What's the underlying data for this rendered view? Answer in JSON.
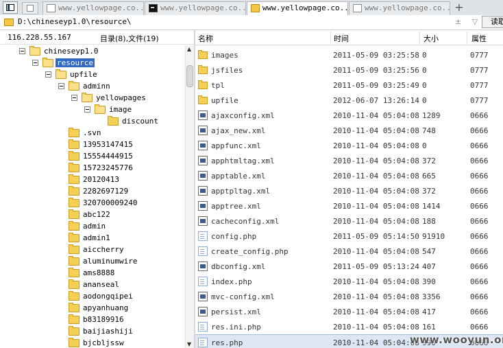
{
  "tabs": [
    {
      "label": "www.yellowpage.co...",
      "icon": "page-icon",
      "active": false
    },
    {
      "label": "www.yellowpage.co...",
      "icon": "terminal-icon",
      "active": false
    },
    {
      "label": "www.yellowpage.co...",
      "icon": "folder-icon",
      "active": true
    },
    {
      "label": "www.yellowpage.co...",
      "icon": "page-icon",
      "active": false
    }
  ],
  "new_tab_label": "+",
  "address": {
    "path": "D:\\chineseyp1.0\\resource\\",
    "buttons": "± ▽",
    "read_button": "读取"
  },
  "info": {
    "ip": "116.228.55.167",
    "counts": "目录(8),文件(19)"
  },
  "tree": [
    {
      "label": "chineseyp1.0",
      "depth": 0,
      "expander": true,
      "selected": false
    },
    {
      "label": "resource",
      "depth": 1,
      "expander": true,
      "selected": true
    },
    {
      "label": "upfile",
      "depth": 2,
      "expander": true,
      "selected": false
    },
    {
      "label": "adminn",
      "depth": 3,
      "expander": true,
      "selected": false
    },
    {
      "label": "yellowpages",
      "depth": 4,
      "expander": true,
      "selected": false
    },
    {
      "label": "image",
      "depth": 5,
      "expander": true,
      "selected": false
    },
    {
      "label": "discount",
      "depth": 6,
      "expander": false,
      "selected": false
    },
    {
      "label": ".svn",
      "depth": 3,
      "expander": false,
      "selected": false
    },
    {
      "label": "13953147415",
      "depth": 3,
      "expander": false,
      "selected": false
    },
    {
      "label": "15554444915",
      "depth": 3,
      "expander": false,
      "selected": false
    },
    {
      "label": "15723245776",
      "depth": 3,
      "expander": false,
      "selected": false
    },
    {
      "label": "20120413",
      "depth": 3,
      "expander": false,
      "selected": false
    },
    {
      "label": "2282697129",
      "depth": 3,
      "expander": false,
      "selected": false
    },
    {
      "label": "320700009240",
      "depth": 3,
      "expander": false,
      "selected": false
    },
    {
      "label": "abc122",
      "depth": 3,
      "expander": false,
      "selected": false
    },
    {
      "label": "admin",
      "depth": 3,
      "expander": false,
      "selected": false
    },
    {
      "label": "admin1",
      "depth": 3,
      "expander": false,
      "selected": false
    },
    {
      "label": "aiccherry",
      "depth": 3,
      "expander": false,
      "selected": false
    },
    {
      "label": "aluminumwire",
      "depth": 3,
      "expander": false,
      "selected": false
    },
    {
      "label": "ams8888",
      "depth": 3,
      "expander": false,
      "selected": false
    },
    {
      "label": "ananseal",
      "depth": 3,
      "expander": false,
      "selected": false
    },
    {
      "label": "aodongqipei",
      "depth": 3,
      "expander": false,
      "selected": false
    },
    {
      "label": "apyanhuang",
      "depth": 3,
      "expander": false,
      "selected": false
    },
    {
      "label": "b83189916",
      "depth": 3,
      "expander": false,
      "selected": false
    },
    {
      "label": "baijiashiji",
      "depth": 3,
      "expander": false,
      "selected": false
    },
    {
      "label": "bjcbljssw",
      "depth": 3,
      "expander": false,
      "selected": false
    }
  ],
  "columns": {
    "name": "名称",
    "time": "时间",
    "size": "大小",
    "attr": "属性"
  },
  "files": [
    {
      "name": "images",
      "type": "dir",
      "time": "2011-05-09 03:25:58",
      "size": "0",
      "attr": "0777"
    },
    {
      "name": "jsfiles",
      "type": "dir",
      "time": "2011-05-09 03:25:56",
      "size": "0",
      "attr": "0777"
    },
    {
      "name": "tpl",
      "type": "dir",
      "time": "2011-05-09 03:25:49",
      "size": "0",
      "attr": "0777"
    },
    {
      "name": "upfile",
      "type": "dir",
      "time": "2012-06-07 13:26:14",
      "size": "0",
      "attr": "0777"
    },
    {
      "name": "ajaxconfig.xml",
      "type": "xml",
      "time": "2010-11-04 05:04:08",
      "size": "1289",
      "attr": "0666"
    },
    {
      "name": "ajax_new.xml",
      "type": "xml",
      "time": "2010-11-04 05:04:08",
      "size": "748",
      "attr": "0666"
    },
    {
      "name": "appfunc.xml",
      "type": "xml",
      "time": "2010-11-04 05:04:08",
      "size": "0",
      "attr": "0666"
    },
    {
      "name": "apphtmltag.xml",
      "type": "xml",
      "time": "2010-11-04 05:04:08",
      "size": "372",
      "attr": "0666"
    },
    {
      "name": "apptable.xml",
      "type": "xml",
      "time": "2010-11-04 05:04:08",
      "size": "665",
      "attr": "0666"
    },
    {
      "name": "apptpltag.xml",
      "type": "xml",
      "time": "2010-11-04 05:04:08",
      "size": "372",
      "attr": "0666"
    },
    {
      "name": "apptree.xml",
      "type": "xml",
      "time": "2010-11-04 05:04:08",
      "size": "1414",
      "attr": "0666"
    },
    {
      "name": "cacheconfig.xml",
      "type": "xml",
      "time": "2010-11-04 05:04:08",
      "size": "188",
      "attr": "0666"
    },
    {
      "name": "config.php",
      "type": "php",
      "time": "2011-05-09 05:14:50",
      "size": "91910",
      "attr": "0666"
    },
    {
      "name": "create_config.php",
      "type": "php",
      "time": "2010-11-04 05:04:08",
      "size": "547",
      "attr": "0666"
    },
    {
      "name": "dbconfig.xml",
      "type": "xml",
      "time": "2011-05-09 05:13:24",
      "size": "407",
      "attr": "0666"
    },
    {
      "name": "index.php",
      "type": "php",
      "time": "2010-11-04 05:04:08",
      "size": "390",
      "attr": "0666"
    },
    {
      "name": "mvc-config.xml",
      "type": "xml",
      "time": "2010-11-04 05:04:08",
      "size": "3356",
      "attr": "0666"
    },
    {
      "name": "persist.xml",
      "type": "xml",
      "time": "2010-11-04 05:04:08",
      "size": "417",
      "attr": "0666"
    },
    {
      "name": "res.ini.php",
      "type": "php",
      "time": "2010-11-04 05:04:08",
      "size": "161",
      "attr": "0666"
    },
    {
      "name": "res.php",
      "type": "php",
      "time": "2010-11-04 05:04:08",
      "size": "990",
      "attr": "0666"
    }
  ],
  "selected_file": "res.php",
  "watermark": "www.wooyun.org"
}
